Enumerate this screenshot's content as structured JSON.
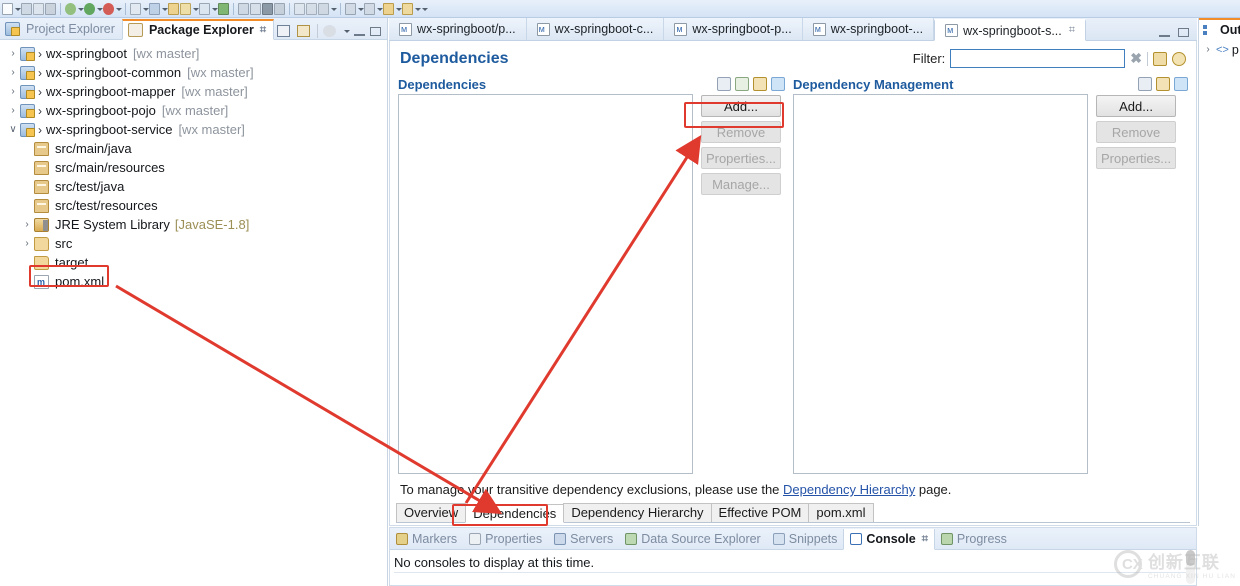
{
  "global_toolbar": {
    "icons": [
      "new-icon",
      "save-icon",
      "save-all-icon",
      "print-icon",
      "debug-icon",
      "run-icon",
      "run-ext-icon",
      "coverage-icon",
      "new-java-project-icon",
      "new-package-icon",
      "new-class-icon",
      "search-icon",
      "open-type-icon",
      "open-task-icon",
      "next-annotation-icon",
      "prev-annotation-icon",
      "last-edit-icon",
      "back-icon",
      "forward-icon",
      "pin-icon"
    ]
  },
  "explorer": {
    "tabs": [
      {
        "label": "Project Explorer",
        "icon": "project-explorer-icon",
        "active": false,
        "closeable": false
      },
      {
        "label": "Package Explorer",
        "icon": "package-explorer-icon",
        "active": true,
        "closeable": true
      }
    ],
    "close_glyph": "⌗",
    "toolbar_icons": [
      "collapse-all-icon",
      "link-with-editor-icon",
      "view-menu-icon",
      "minimize-icon",
      "maximize-icon",
      "filter-icon"
    ],
    "tree": [
      {
        "twist": "›",
        "icon": "maven-project-icon",
        "gt": "›",
        "label": "wx-springboot",
        "suffix": "[wx master]",
        "suffix_kind": "git",
        "indent": 0
      },
      {
        "twist": "›",
        "icon": "maven-project-icon",
        "gt": "›",
        "label": "wx-springboot-common",
        "suffix": "[wx master]",
        "suffix_kind": "git",
        "indent": 0
      },
      {
        "twist": "›",
        "icon": "maven-project-icon",
        "gt": "›",
        "label": "wx-springboot-mapper",
        "suffix": "[wx master]",
        "suffix_kind": "git",
        "indent": 0
      },
      {
        "twist": "›",
        "icon": "maven-project-icon",
        "gt": "›",
        "label": "wx-springboot-pojo",
        "suffix": "[wx master]",
        "suffix_kind": "git",
        "indent": 0
      },
      {
        "twist": "∨",
        "icon": "maven-project-icon",
        "gt": "›",
        "label": "wx-springboot-service",
        "suffix": "[wx master]",
        "suffix_kind": "git",
        "indent": 0
      },
      {
        "twist": "",
        "icon": "source-folder-icon",
        "gt": "",
        "label": "src/main/java",
        "suffix": "",
        "suffix_kind": "",
        "indent": 1
      },
      {
        "twist": "",
        "icon": "source-folder-icon",
        "gt": "",
        "label": "src/main/resources",
        "suffix": "",
        "suffix_kind": "",
        "indent": 1
      },
      {
        "twist": "",
        "icon": "source-folder-icon",
        "gt": "",
        "label": "src/test/java",
        "suffix": "",
        "suffix_kind": "",
        "indent": 1
      },
      {
        "twist": "",
        "icon": "source-folder-icon",
        "gt": "",
        "label": "src/test/resources",
        "suffix": "",
        "suffix_kind": "",
        "indent": 1
      },
      {
        "twist": "›",
        "icon": "jre-library-icon",
        "gt": "",
        "label": "JRE System Library",
        "suffix": "[JavaSE-1.8]",
        "suffix_kind": "jre",
        "indent": 1
      },
      {
        "twist": "›",
        "icon": "folder-icon",
        "gt": "",
        "label": "src",
        "suffix": "",
        "suffix_kind": "",
        "indent": 1
      },
      {
        "twist": "",
        "icon": "folder-icon",
        "gt": "",
        "label": "target",
        "suffix": "",
        "suffix_kind": "",
        "indent": 1
      },
      {
        "twist": "",
        "icon": "xml-file-icon",
        "gt": "",
        "label": "pom.xml",
        "suffix": "",
        "suffix_kind": "",
        "indent": 1,
        "highlighted": true
      }
    ]
  },
  "editor": {
    "tabs": [
      {
        "label": "wx-springboot/p...",
        "icon": "maven-pom-icon",
        "active": false
      },
      {
        "label": "wx-springboot-c...",
        "icon": "maven-pom-icon",
        "active": false
      },
      {
        "label": "wx-springboot-p...",
        "icon": "maven-pom-icon",
        "active": false
      },
      {
        "label": "wx-springboot-...",
        "icon": "maven-pom-icon",
        "active": false
      },
      {
        "label": "wx-springboot-s...",
        "icon": "maven-pom-icon",
        "active": true
      }
    ],
    "close_glyph": "⌗",
    "window_buttons": [
      "minimize-icon",
      "maximize-icon"
    ],
    "form_title": "Dependencies",
    "filter": {
      "label": "Filter:",
      "value": "",
      "placeholder": "",
      "clear_glyph": "✖",
      "icons": [
        "filter-group-icon",
        "filter-settings-icon"
      ]
    },
    "left_section": {
      "title": "Dependencies",
      "tool_icons": [
        "sort-az-icon",
        "hierarchy-icon",
        "columns-icon",
        "expand-all-icon"
      ],
      "items": [],
      "buttons": [
        {
          "label": "Add...",
          "enabled": true
        },
        {
          "label": "Remove",
          "enabled": false
        },
        {
          "label": "Properties...",
          "enabled": false
        },
        {
          "label": "Manage...",
          "enabled": false
        }
      ]
    },
    "right_section": {
      "title": "Dependency Management",
      "tool_icons": [
        "sort-az-icon",
        "columns-icon",
        "expand-all-icon"
      ],
      "items": [],
      "buttons": [
        {
          "label": "Add...",
          "enabled": true
        },
        {
          "label": "Remove",
          "enabled": false
        },
        {
          "label": "Properties...",
          "enabled": false
        }
      ]
    },
    "note": {
      "prefix": "To manage your transitive dependency exclusions, please use the ",
      "link": "Dependency Hierarchy",
      "suffix": " page."
    },
    "page_tabs": [
      {
        "label": "Overview",
        "active": false
      },
      {
        "label": "Dependencies",
        "active": true
      },
      {
        "label": "Dependency Hierarchy",
        "active": false
      },
      {
        "label": "Effective POM",
        "active": false
      },
      {
        "label": "pom.xml",
        "active": false
      }
    ]
  },
  "outline": {
    "tab_label": "Out",
    "tab_icon": "outline-icon",
    "row": {
      "twist": "›",
      "icon": "xml-element-icon",
      "label": "p"
    }
  },
  "bottom": {
    "tabs": [
      {
        "label": "Markers",
        "icon": "markers-icon",
        "color": "#c8a84b",
        "active": false
      },
      {
        "label": "Properties",
        "icon": "properties-icon",
        "color": "#b9c2cc",
        "active": false
      },
      {
        "label": "Servers",
        "icon": "servers-icon",
        "color": "#7fa9d8",
        "active": false
      },
      {
        "label": "Data Source Explorer",
        "icon": "data-source-icon",
        "color": "#7ab87a",
        "active": false
      },
      {
        "label": "Snippets",
        "icon": "snippets-icon",
        "color": "#9fb8d4",
        "active": false
      },
      {
        "label": "Console",
        "icon": "console-icon",
        "color": "#4a80c0",
        "active": true
      },
      {
        "label": "Progress",
        "icon": "progress-icon",
        "color": "#7aab7a",
        "active": false
      }
    ],
    "close_glyph": "⌗",
    "console_message": "No consoles to display at this time."
  },
  "annotations": {
    "color": "#e03a2f",
    "boxes": [
      {
        "name": "pom-xml-highlight"
      },
      {
        "name": "add-button-highlight"
      },
      {
        "name": "dependencies-tab-highlight"
      }
    ],
    "arrows": [
      {
        "name": "arrow-pom-to-dependencies-tab"
      },
      {
        "name": "arrow-dependencies-tab-to-add"
      }
    ]
  },
  "watermark": {
    "cn": "创新互联",
    "en": "CHUANG XIN HU LIAN",
    "mark": "CX"
  }
}
